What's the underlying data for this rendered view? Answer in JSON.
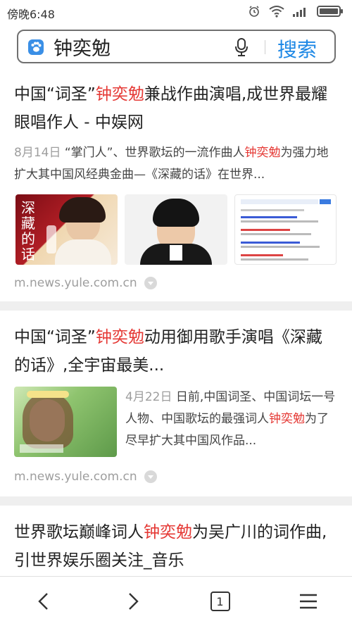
{
  "status_bar": {
    "time": "傍晚6:48",
    "icons": [
      "alarm-icon",
      "wifi-icon",
      "signal-icon",
      "battery-icon"
    ]
  },
  "search": {
    "value": "钟奕勉",
    "button_label": "搜索",
    "icons": [
      "baidu-paw-icon",
      "microphone-icon"
    ]
  },
  "results": [
    {
      "title_parts": [
        "中国“词圣”",
        "钟奕勉",
        "兼战作曲演唱,成世界最耀眼唱作人 - 中娱网"
      ],
      "date": "8月14日",
      "snippet_parts": [
        " “掌门人”、世界歌坛的一流作曲人",
        "钟奕勉",
        "为强力地扩大其中国风经典金曲—《深藏的话》在世界..."
      ],
      "image_texts": [
        "深藏的话"
      ],
      "source": "m.news.yule.com.cn"
    },
    {
      "title_parts": [
        "中国“词圣”",
        "钟奕勉",
        "动用御用歌手演唱《深藏的话》,全宇宙最美..."
      ],
      "date": "4月22日",
      "snippet_parts": [
        " 日前,中国词圣、中国词坛一号人物、中国歌坛的最强词人",
        "钟奕勉",
        "为了尽早扩大其中国风作品..."
      ],
      "source": "m.news.yule.com.cn"
    },
    {
      "title_parts": [
        "世界歌坛巅峰词人",
        "钟奕勉",
        "为吴广川的词作曲,引世界娱乐圈关注_音乐"
      ]
    }
  ],
  "bottom_nav": {
    "tab_count": "1",
    "icons": [
      "back-icon",
      "forward-icon",
      "tabs-icon",
      "menu-icon"
    ]
  },
  "colors": {
    "highlight": "#e53935",
    "accent": "#1e88e5"
  }
}
